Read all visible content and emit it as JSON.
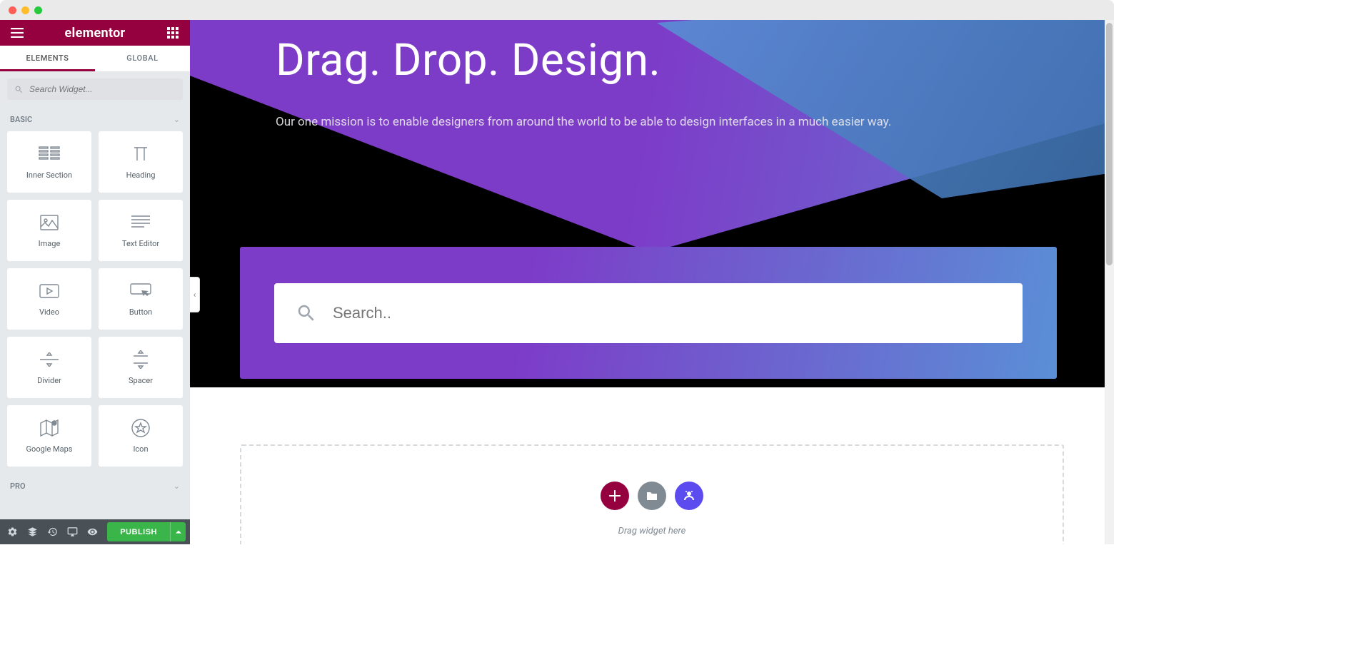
{
  "brand": "elementor",
  "tabs": {
    "elements": "ELEMENTS",
    "global": "GLOBAL"
  },
  "search": {
    "placeholder": "Search Widget..."
  },
  "categories": {
    "basic": "BASIC",
    "pro": "PRO"
  },
  "widgets": [
    {
      "label": "Inner Section",
      "icon": "inner-section"
    },
    {
      "label": "Heading",
      "icon": "heading"
    },
    {
      "label": "Image",
      "icon": "image"
    },
    {
      "label": "Text Editor",
      "icon": "text-editor"
    },
    {
      "label": "Video",
      "icon": "video"
    },
    {
      "label": "Button",
      "icon": "button"
    },
    {
      "label": "Divider",
      "icon": "divider"
    },
    {
      "label": "Spacer",
      "icon": "spacer"
    },
    {
      "label": "Google Maps",
      "icon": "maps"
    },
    {
      "label": "Icon",
      "icon": "icon"
    }
  ],
  "footer": {
    "publish": "PUBLISH"
  },
  "hero": {
    "title": "Drag. Drop. Design.",
    "sub": "Our one mission is to enable designers from around the world to be able to design interfaces in a much easier way.",
    "search_placeholder": "Search.."
  },
  "dropzone": {
    "hint": "Drag widget here"
  }
}
